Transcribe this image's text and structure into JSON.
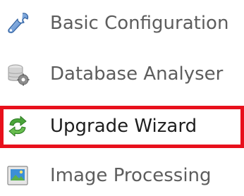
{
  "menu": {
    "items": [
      {
        "label": "Basic Configuration",
        "icon": "wrench-icon",
        "active": false
      },
      {
        "label": "Database Analyser",
        "icon": "database-gear-icon",
        "active": false
      },
      {
        "label": "Upgrade Wizard",
        "icon": "refresh-arrows-icon",
        "active": true
      },
      {
        "label": "Image Processing",
        "icon": "picture-icon",
        "active": false
      }
    ],
    "highlight_color": "#e8101c"
  }
}
